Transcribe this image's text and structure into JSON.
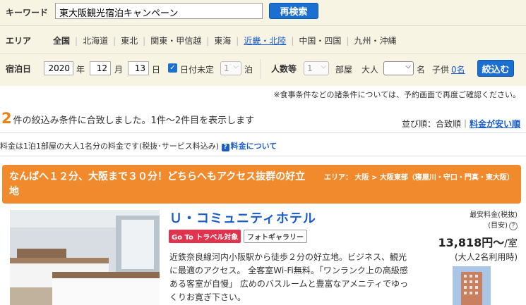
{
  "search": {
    "keyword_label": "キーワード",
    "keyword_value": "東大阪観光宿泊キャンペーン",
    "research_button": "再検索",
    "area_label": "エリア",
    "areas": [
      "全国",
      "北海道",
      "東北",
      "関東・甲信越",
      "東海",
      "近畿・北陸",
      "中国・四国",
      "九州・沖縄"
    ],
    "stay_label": "宿泊日",
    "year": "2020",
    "year_unit": "年",
    "month": "12",
    "month_unit": "月",
    "day": "13",
    "day_unit": "日",
    "date_undecided": "日付未定",
    "nights": "1",
    "nights_unit": "泊",
    "people_label": "人数等",
    "rooms": "1",
    "rooms_unit": "部屋",
    "adult_label": "大人",
    "adult_unit": "名",
    "child_label": "子供",
    "child_link": "0名",
    "filter_button": "絞込む"
  },
  "notice": "※食事条件などの諸条件については、予約画面で再度ご確認ください。",
  "results": {
    "count": "2",
    "text": "件の絞込み条件に合致しました。1件〜2件目を表示します",
    "sort_label": "並び順：合致順｜",
    "sort_link": "料金が安い順",
    "price_note": "料金は1泊1部屋の大人1名分の料金です(税抜･サービス料込み)",
    "price_help": "料金について"
  },
  "banner": {
    "title": "なんばへ１２分、大阪まで３０分！どちらへもアクセス抜群の好立地",
    "area": "エリア： 大阪 > 大阪東部（寝屋川・守口・門真・東大阪）"
  },
  "hotel": {
    "name": "Ｕ・コミュニティホテル",
    "tag_goto": "Go To トラベル対象",
    "tag_photo": "フォトギャラリー",
    "description": "近鉄奈良線河内小阪駅から徒歩２分の好立地。ビジネス、観光に最適のアクセス。 全客室Wi-Fi無料。「ワンランク上の高級感ある客室が自慢」 広めのバスルームと豊富なアメニティでゆっくりお寛ぎ下さい。",
    "price_label_1": "最安料金(税抜)",
    "price_label_2": "(目安)",
    "price": "13,818円〜",
    "price_unit": "/室",
    "price_sub": "(大人2名利用時)"
  },
  "colors": {
    "accent_orange": "#f08a2c",
    "link_blue": "#1a5cc8",
    "button_blue": "#1b6fd1",
    "panel_bg": "#f7f4e4"
  }
}
